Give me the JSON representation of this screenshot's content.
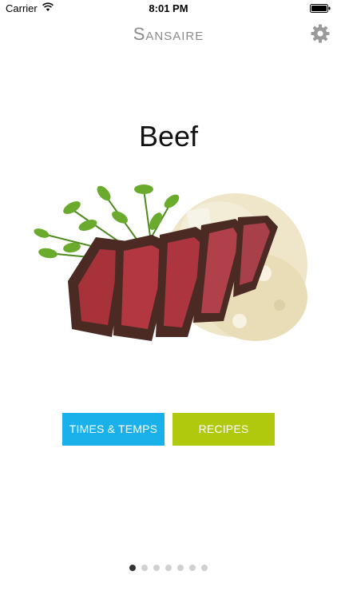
{
  "status_bar": {
    "carrier": "Carrier",
    "time": "8:01 PM"
  },
  "header": {
    "logo_text": "Sansaire",
    "settings_icon": "gear-icon"
  },
  "main": {
    "title": "Beef",
    "image": "steak-with-mashed-potatoes-and-sprouts"
  },
  "actions": {
    "times_temps_label": "TIMES & TEMPS",
    "recipes_label": "RECIPES",
    "times_temps_color": "#1ab0ea",
    "recipes_color": "#b1c90d"
  },
  "pager": {
    "page_count": 7,
    "active_page": 1
  }
}
